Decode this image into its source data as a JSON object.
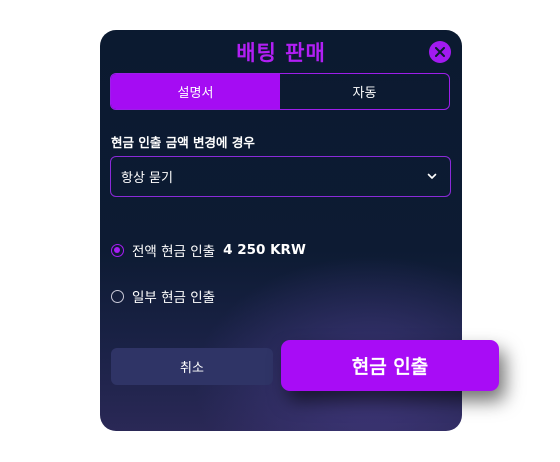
{
  "modal": {
    "title": "배팅 판매",
    "close_icon": "close-icon"
  },
  "tabs": [
    {
      "label": "설명서",
      "active": true
    },
    {
      "label": "자동",
      "active": false
    }
  ],
  "section_label": "현금 인출 금액 변경에 경우",
  "select": {
    "value": "항상 묻기",
    "icon": "chevron-down-icon"
  },
  "options": [
    {
      "label": "전액 현금 인출",
      "amount": "4 250 KRW",
      "checked": true
    },
    {
      "label": "일부 현금 인출",
      "checked": false
    }
  ],
  "buttons": {
    "cancel": "취소",
    "withdraw": "현금 인출"
  },
  "colors": {
    "accent": "#a50cf3",
    "background": "#0b1a30",
    "cancel_bg": "#2f3466"
  }
}
